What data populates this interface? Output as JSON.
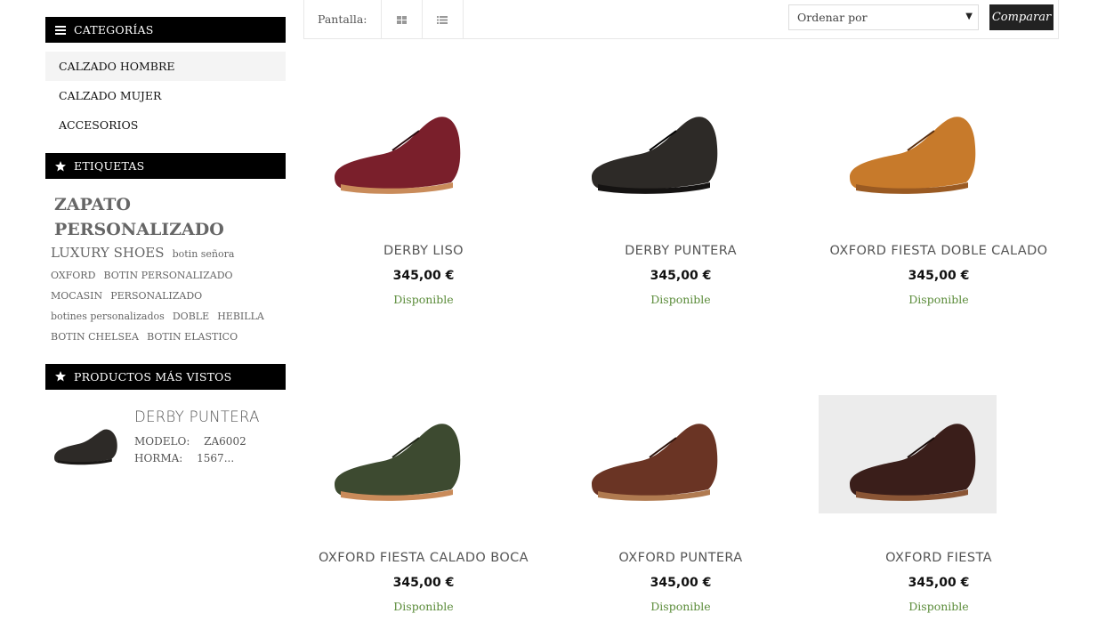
{
  "sidebar": {
    "categories": {
      "title": "CATEGORÍAS",
      "items": [
        {
          "label": "CALZADO HOMBRE"
        },
        {
          "label": "CALZADO MUJER"
        },
        {
          "label": "ACCESORIOS"
        }
      ]
    },
    "tags": {
      "title": "ETIQUETAS",
      "items": [
        "ZAPATO PERSONALIZADO",
        "LUXURY SHOES",
        "botin señora",
        "OXFORD",
        "BOTIN PERSONALIZADO",
        "MOCASIN",
        "PERSONALIZADO",
        "botines personalizados",
        "DOBLE",
        "HEBILLA",
        "BOTIN CHELSEA",
        "BOTIN ELASTICO"
      ]
    },
    "most_viewed": {
      "title": "PRODUCTOS MÁS VISTOS",
      "item_title": "DERBY PUNTERA",
      "item_desc": "MODELO: ZA6002 HORMA: 1567..."
    }
  },
  "toolbar": {
    "display_label": "Pantalla:",
    "grid_icon": "grid-view-icon",
    "list_icon": "list-view-icon",
    "sort_value": "Ordenar por",
    "compare_label": "Comparar"
  },
  "products": [
    {
      "title": "DERBY LISO",
      "price": "345,00 €",
      "stock": "Disponible",
      "shoe_color": "#7a1f2b"
    },
    {
      "title": "DERBY PUNTERA",
      "price": "345,00 €",
      "stock": "Disponible",
      "shoe_color": "#2d2a27"
    },
    {
      "title": "OXFORD FIESTA DOBLE CALADO",
      "price": "345,00 €",
      "stock": "Disponible",
      "shoe_color": "#c77a2b"
    },
    {
      "title": "OXFORD FIESTA CALADO BOCA",
      "price": "345,00 €",
      "stock": "Disponible",
      "shoe_color": "#3d4a30"
    },
    {
      "title": "OXFORD PUNTERA",
      "price": "345,00 €",
      "stock": "Disponible",
      "shoe_color": "#6a3424"
    },
    {
      "title": "OXFORD FIESTA",
      "price": "345,00 €",
      "stock": "Disponible",
      "shoe_color": "#3a1e1a"
    }
  ],
  "colors": {
    "header_bg": "#000000",
    "available_green": "#5b8c3a",
    "compare_bg": "#222222"
  }
}
